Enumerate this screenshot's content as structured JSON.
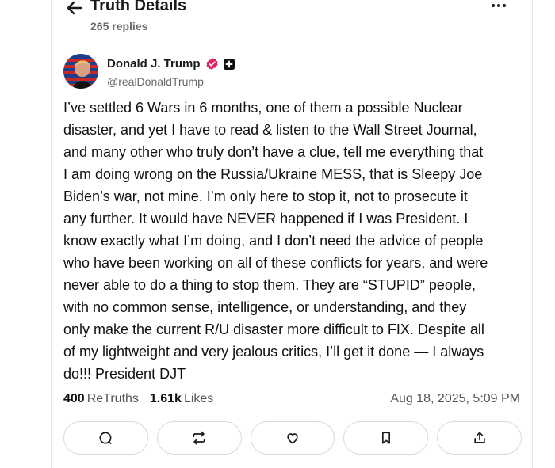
{
  "header": {
    "title": "Truth Details",
    "replies": "265 replies",
    "back_icon": "arrow-left-icon",
    "more_icon": "more-horizontal-icon"
  },
  "post": {
    "author_name": "Donald J. Trump",
    "handle": "@realDonaldTrump",
    "text": "I’ve settled 6 Wars in 6 months, one of them a possible Nuclear\ndisaster, and yet I have to read & listen to the Wall Street Journal,\nand many other who truly don’t have a clue, tell me everything that\nI am doing wrong on the Russia/Ukraine MESS, that is Sleepy Joe\nBiden’s war, not mine. I’m only here to stop it, not to prosecute it\nany further. It would have NEVER happened if I was President. I\nknow exactly what I’m doing, and I don’t need the advice of people\nwho have been working on all of these conflicts for years, and were\nnever able to do a thing to stop them. They are “STUPID” people,\nwith no common sense, intelligence, or understanding, and they\nonly make the current R/U disaster more difficult to FIX. Despite all\nof my lightweight and very jealous critics, I’ll get it done — I always\ndo!!! President DJT",
    "retruths_count": "400",
    "retruths_label": "ReTruths",
    "likes_count": "1.61k",
    "likes_label": "Likes",
    "timestamp": "Aug 18, 2025, 5:09 PM"
  },
  "actions": [
    "reply-icon",
    "retruth-icon",
    "like-icon",
    "bookmark-icon",
    "share-icon"
  ],
  "colors": {
    "verified": "#e0245e",
    "text": "#111111",
    "muted": "#6b6b6b"
  }
}
